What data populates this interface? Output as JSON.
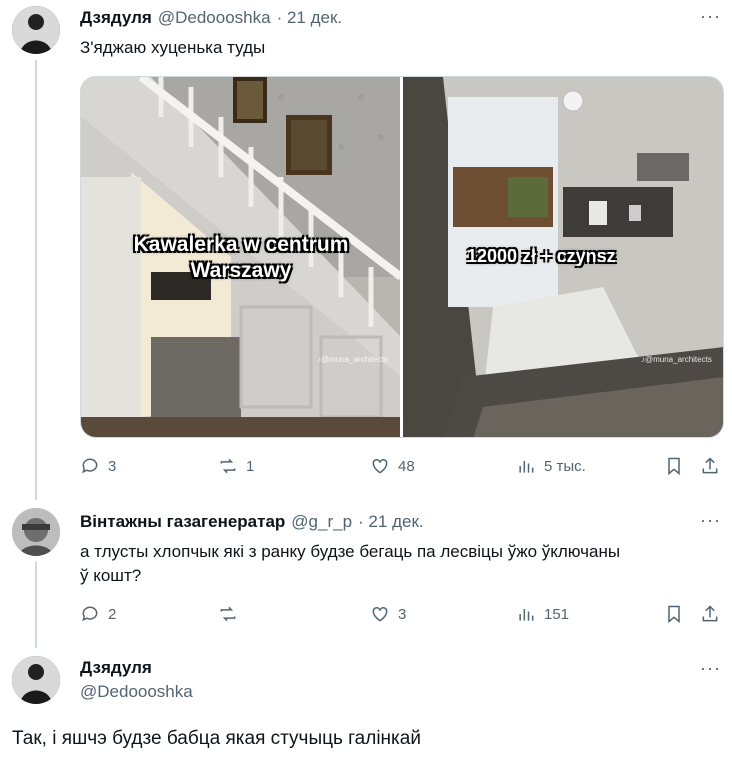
{
  "tweet1": {
    "author_name": "Дзядуля",
    "handle": "@Dedoooshka",
    "date": "· 21 дек.",
    "text": "З'яджаю хуценька туды",
    "more": "···",
    "media": {
      "left_caption_line1": "Kawalerka w centrum",
      "left_caption_line2": "Warszawy",
      "right_caption": "12000 zł + czynsz",
      "watermark": "♪@muna_architects"
    },
    "actions": {
      "replies": "3",
      "reposts": "1",
      "likes": "48",
      "views": "5 тыс."
    }
  },
  "tweet2": {
    "author_name": "Вінтажны газагенератар",
    "handle": "@g_r_p",
    "date": "· 21 дек.",
    "more": "···",
    "text_line1": "а тлусты хлопчык які з ранку будзе бегаць па лесвіцы ўжо ўключаны",
    "text_line2": "ў кошт?",
    "actions": {
      "replies": "2",
      "reposts": "",
      "likes": "3",
      "views": "151"
    }
  },
  "tweet3": {
    "author_name": "Дзядуля",
    "handle": "@Dedoooshka",
    "more": "···",
    "text": "Так, і яшчэ будзе бабца якая стучыць галінкай"
  },
  "colors": {
    "text_primary": "#0f1419",
    "text_secondary": "#536471",
    "thread_line": "#cfd9de"
  }
}
